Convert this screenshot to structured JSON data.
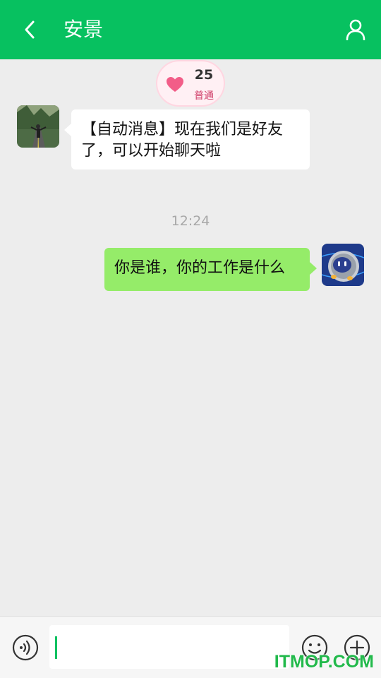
{
  "header": {
    "title": "安景",
    "back_icon": "chevron-left-icon",
    "profile_icon": "person-icon",
    "color": "#07c160"
  },
  "intimacy": {
    "score": "25",
    "level": "普通",
    "icon": "heart-icon"
  },
  "messages": [
    {
      "side": "left",
      "text": "【自动消息】现在我们是好友了，可以开始聊天啦"
    },
    {
      "side": "right",
      "text": "你是谁，你的工作是什么"
    }
  ],
  "timestamp": "12:24",
  "input": {
    "value": "",
    "voice_icon": "voice-icon",
    "emoji_icon": "smiley-icon",
    "plus_icon": "plus-circle-icon"
  },
  "watermark": "ITMOP.COM"
}
